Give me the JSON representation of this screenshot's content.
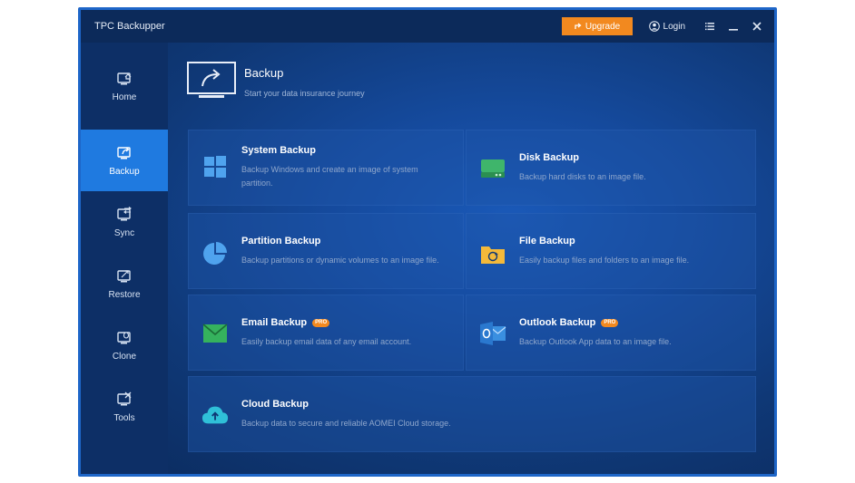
{
  "window": {
    "title": "TPC Backupper",
    "upgrade_label": "Upgrade",
    "login_label": "Login"
  },
  "sidebar": {
    "items": [
      {
        "label": "Home",
        "icon": "home-icon"
      },
      {
        "label": "Backup",
        "icon": "backup-icon",
        "active": true
      },
      {
        "label": "Sync",
        "icon": "sync-icon"
      },
      {
        "label": "Restore",
        "icon": "restore-icon"
      },
      {
        "label": "Clone",
        "icon": "clone-icon"
      },
      {
        "label": "Tools",
        "icon": "tools-icon"
      }
    ]
  },
  "header": {
    "title": "Backup",
    "subtitle": "Start your data insurance journey"
  },
  "cards": [
    {
      "title": "System Backup",
      "desc": "Backup Windows and create an image of system partition.",
      "icon": "windows-icon"
    },
    {
      "title": "Disk Backup",
      "desc": "Backup hard disks to an image file.",
      "icon": "disk-icon"
    },
    {
      "title": "Partition Backup",
      "desc": "Backup partitions or dynamic volumes to an image file.",
      "icon": "pie-chart-icon"
    },
    {
      "title": "File Backup",
      "desc": "Easily backup files and folders to an image file.",
      "icon": "folder-icon"
    },
    {
      "title": "Email Backup",
      "desc": "Easily backup email data of any email account.",
      "icon": "envelope-icon",
      "badge": "PRO"
    },
    {
      "title": "Outlook Backup",
      "desc": "Backup Outlook App data to an image file.",
      "icon": "outlook-icon",
      "badge": "PRO"
    },
    {
      "title": "Cloud Backup",
      "desc": "Backup data to secure and reliable AOMEI Cloud storage.",
      "icon": "cloud-upload-icon"
    }
  ],
  "colors": {
    "accent": "#1f7ae0",
    "upgrade": "#f2891f",
    "sidebar": "#0d2f66",
    "titlebar": "#0c2a5a"
  }
}
